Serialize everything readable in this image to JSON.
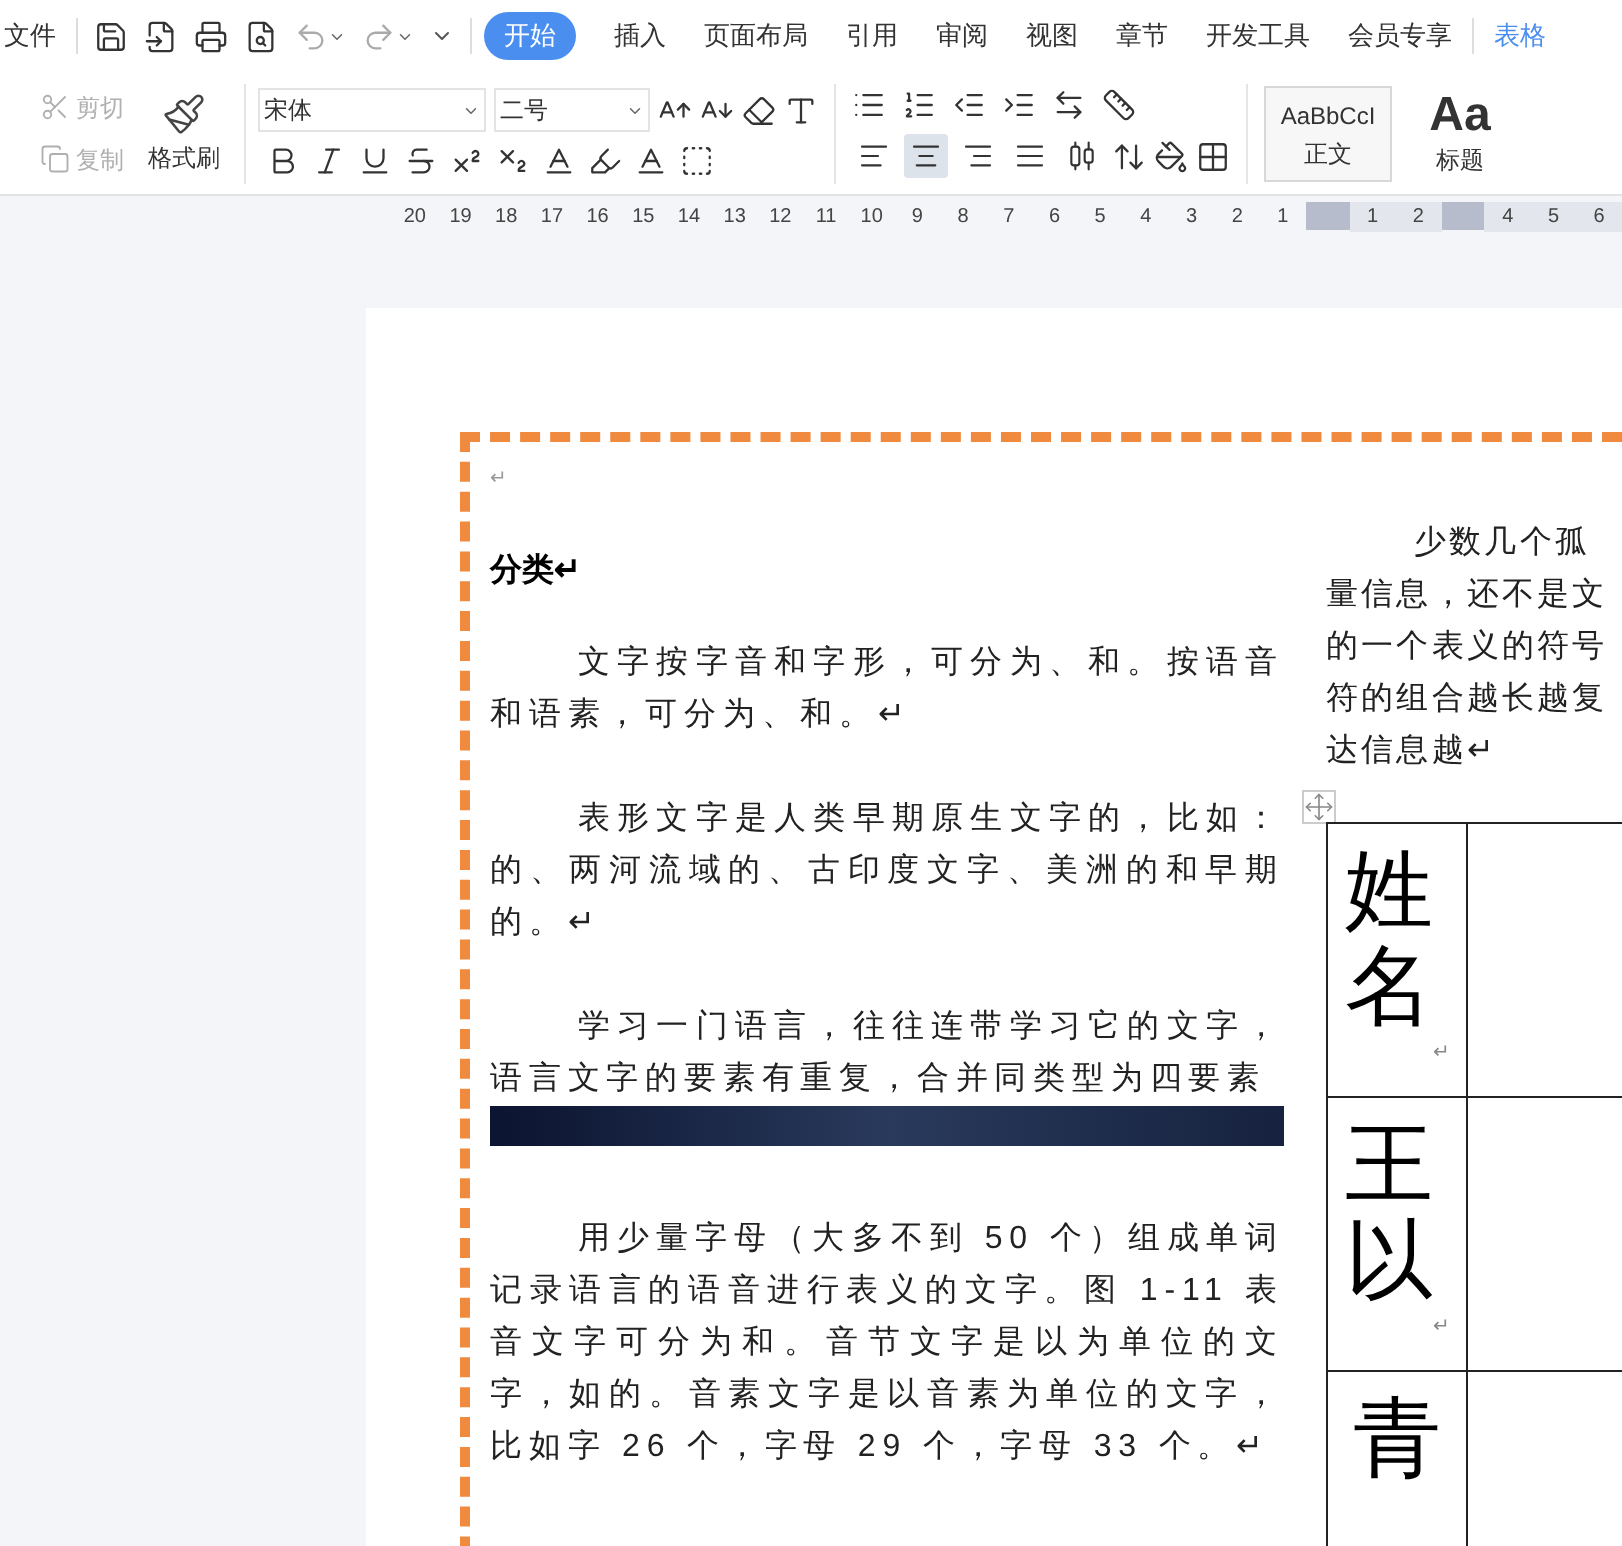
{
  "menu_bar": {
    "file_menu": "文件",
    "tabs": [
      {
        "label": "开始",
        "selected": true
      },
      {
        "label": "插入",
        "selected": false
      },
      {
        "label": "页面布局",
        "selected": false
      },
      {
        "label": "引用",
        "selected": false
      },
      {
        "label": "审阅",
        "selected": false
      },
      {
        "label": "视图",
        "selected": false
      },
      {
        "label": "章节",
        "selected": false
      },
      {
        "label": "开发工具",
        "selected": false
      },
      {
        "label": "会员专享",
        "selected": false
      }
    ],
    "cut_tab": "表格"
  },
  "ribbon": {
    "clipboard": [
      {
        "kind": "cut",
        "label": "剪切",
        "disabled": true
      },
      {
        "kind": "copy",
        "label": "复制",
        "disabled": true
      }
    ],
    "format_painter": "格式刷",
    "font_family": "宋体",
    "font_size": "二号",
    "align_buttons": [
      {
        "kind": "left",
        "selected": false
      },
      {
        "kind": "center",
        "selected": true
      },
      {
        "kind": "right",
        "selected": false
      },
      {
        "kind": "justify",
        "selected": false
      },
      {
        "kind": "distribute",
        "selected": false
      }
    ],
    "styles": [
      {
        "preview": "AaBbCcI",
        "label": "正文",
        "kind": "body"
      },
      {
        "preview": "Aa",
        "label": "标题",
        "kind": "heading"
      }
    ]
  },
  "ruler": {
    "left_numbers": [
      "20",
      "19",
      "18",
      "17",
      "16",
      "15",
      "14",
      "13",
      "12",
      "11",
      "10",
      "9",
      "8",
      "7",
      "6",
      "5",
      "4",
      "3",
      "2",
      "1"
    ],
    "right_numbers": [
      "1",
      "2",
      "4",
      "5",
      "6"
    ]
  },
  "document": {
    "left_column": [
      {
        "kind": "empty",
        "text": "↵"
      },
      {
        "kind": "heading",
        "text": "分类↵"
      },
      {
        "kind": "paragraph",
        "text": "文字按字音和字形，可分为、和。按语音和语素，可分为、和。↵"
      },
      {
        "kind": "paragraph",
        "text": "表形文字是人类早期原生文字的，比如：的、两河流域的、古印度文字、美洲的和早期的。↵"
      },
      {
        "kind": "paragraph",
        "text": "学习一门语言，往往连带学习它的文字，语言文字的要素有重复，合并同类型为四要素"
      },
      {
        "kind": "image"
      },
      {
        "kind": "paragraph",
        "text": "用少量字母（大多不到 50 个）组成单词记录语言的语音进行表义的文字。图 1-11 表音文字可分为和。音节文字是以为单位的文字，如的。音素文字是以音素为单位的文字，比如字 26 个，字母 29 个，字母 33 个。↵"
      }
    ],
    "right_column": [
      "少数几个孤",
      "量信息，还不是文",
      "的一个表义的符号",
      "符的组合越长越复",
      "达信息越↵"
    ],
    "table": [
      {
        "text": "姓名",
        "end_mark": "↵"
      },
      {
        "text": "王以",
        "end_mark": "↵"
      },
      {
        "text": "青"
      }
    ]
  }
}
